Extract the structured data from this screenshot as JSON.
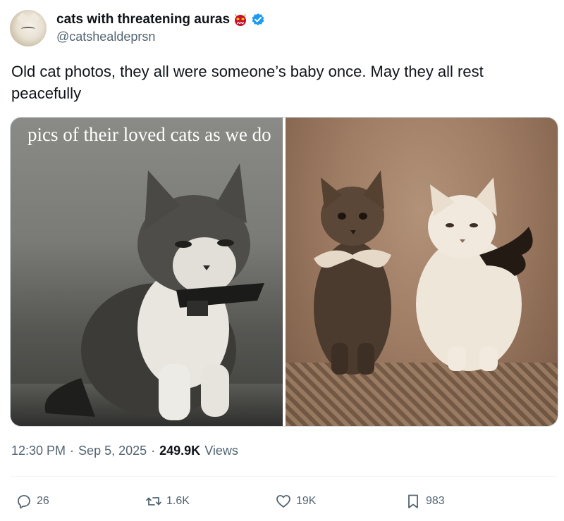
{
  "tweet": {
    "author": {
      "display_name": "cats with threatening auras",
      "handle": "@catshealdeprsn",
      "emoji_icon": "oni-mask-icon",
      "verified_icon": "verified-badge-icon"
    },
    "text": "Old cat photos, they all were someone’s baby once. May they all rest peacefully",
    "media": {
      "left_caption": "pics of their loved cats as we do"
    },
    "meta": {
      "time": "12:30 PM",
      "separator": "·",
      "date": "Sep 5, 2025",
      "views_count": "249.9K",
      "views_label": "Views"
    },
    "actions": {
      "replies": "26",
      "reposts": "1.6K",
      "likes": "19K",
      "bookmarks": "983"
    }
  },
  "colors": {
    "text_primary": "#0f1419",
    "text_secondary": "#536471",
    "verified_blue": "#1d9bf0",
    "divider": "#eff3f4"
  }
}
